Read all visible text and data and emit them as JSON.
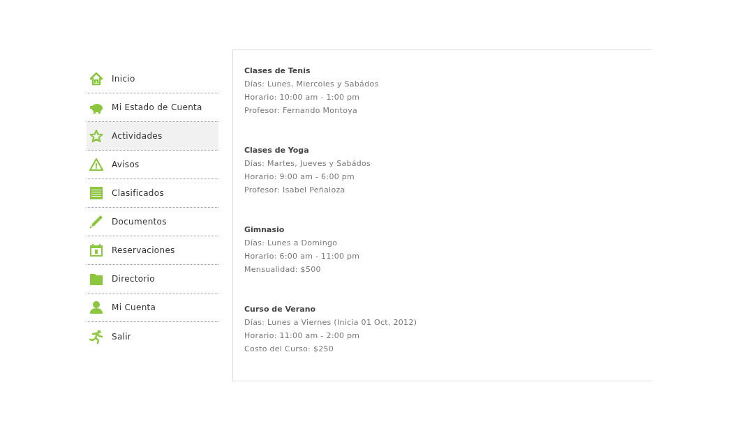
{
  "sidebar": {
    "items": [
      {
        "label": "Inicio",
        "selected": false
      },
      {
        "label": "Mi Estado de Cuenta",
        "selected": false
      },
      {
        "label": "Actividades",
        "selected": true
      },
      {
        "label": "Avisos",
        "selected": false
      },
      {
        "label": "Clasificados",
        "selected": false
      },
      {
        "label": "Documentos",
        "selected": false
      },
      {
        "label": "Reservaciones",
        "selected": false
      },
      {
        "label": "Directorio",
        "selected": false
      },
      {
        "label": "Mi Cuenta",
        "selected": false
      },
      {
        "label": "Salir",
        "selected": false
      }
    ]
  },
  "activities": [
    {
      "title": "Clases de Tenis",
      "lines": [
        "Días: Lunes, Miercoles y Sabádos",
        "Horario: 10:00 am - 1:00 pm",
        "Profesor: Fernando Montoya"
      ]
    },
    {
      "title": "Clases de Yoga",
      "lines": [
        "Días: Martes, Jueves y Sabádos",
        "Horario: 9:00 am - 6:00 pm",
        "Profesor: Isabel Peñaloza"
      ]
    },
    {
      "title": "Gimnasio",
      "lines": [
        "Días: Lunes a Domingo",
        "Horario: 6:00 am - 11:00 pm",
        "Mensualidad: $500"
      ]
    },
    {
      "title": "Curso de Verano",
      "lines": [
        "Días: Lunes a Viernes (Inicia 01 Oct, 2012)",
        "Horario: 11:00 am - 2:00 pm",
        "Costo del Curso: $250"
      ]
    }
  ]
}
